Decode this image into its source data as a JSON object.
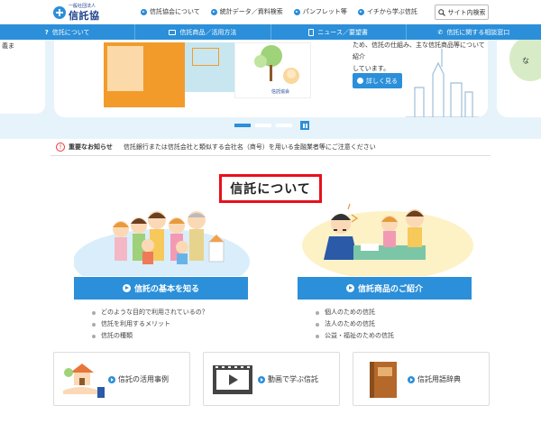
{
  "logo": {
    "org": "一般社団法人",
    "name": "信託協会"
  },
  "header_nav": [
    {
      "label": "信託協会について"
    },
    {
      "label": "統計データ／資料検索"
    },
    {
      "label": "パンフレット等"
    },
    {
      "label": "イチから学ぶ信託"
    }
  ],
  "site_search": "サイト内検索",
  "main_nav": [
    {
      "label": "信託について",
      "icon": "question-icon"
    },
    {
      "label": "信託商品／活用方法",
      "icon": "car-icon"
    },
    {
      "label": "ニュース／要望書",
      "icon": "document-icon"
    },
    {
      "label": "信託に関する相談窓口",
      "icon": "phone-icon"
    }
  ],
  "hero": {
    "left_fragment": "義ま",
    "text_lines": [
      "ため、信託の仕組み、主な信託商品等について紹介",
      "しています。"
    ],
    "more_button": "詳しく見る",
    "book_brand": "信託協会"
  },
  "notice": {
    "label": "重要なお知らせ",
    "text": "信託銀行または信託会社と類似する会社名（商号）を用いる金融業者等にご注意ください"
  },
  "section_title": "信託について",
  "blocks": [
    {
      "button": "信託の基本を知る",
      "items": [
        "どのような目的で利用されているの？",
        "信託を利用するメリット",
        "信託の種類"
      ]
    },
    {
      "button": "信託商品のご紹介",
      "items": [
        "個人のための信託",
        "法人のための信託",
        "公益・福祉のための信託"
      ]
    }
  ],
  "cards": [
    {
      "label": "信託の活用事例",
      "icon": "house-hand-icon"
    },
    {
      "label": "動画で学ぶ信託",
      "icon": "video-icon"
    },
    {
      "label": "信託用語辞典",
      "icon": "book-icon"
    }
  ],
  "colors": {
    "accent": "#2b8fd9",
    "alert": "#e8101b",
    "hero_bg": "#e7f3fb"
  }
}
